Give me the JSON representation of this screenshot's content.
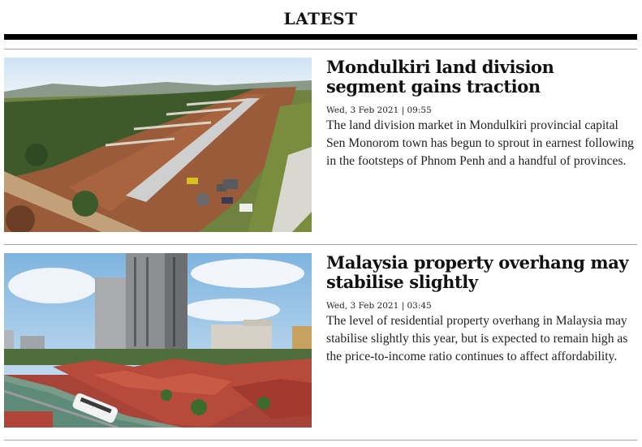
{
  "section": {
    "title": "LATEST"
  },
  "articles": [
    {
      "headline": "Mondulkiri land division segment gains traction",
      "date": "Wed, 3 Feb 2021 | 09:55",
      "summary": "The land division market in Mondulkiri provincial capital Sen Monorom town has begun to sprout in earnest following in the footsteps of Phnom Penh and a handful of provinces.",
      "image": "aerial-photo-land-plots"
    },
    {
      "headline": "Malaysia property overhang may stabilise slightly",
      "date": "Wed, 3 Feb 2021 | 03:45",
      "summary": "The level of residential property overhang in Malaysia may stabilise slightly this year, but is expected to remain high as the price-to-income ratio continues to affect affordability.",
      "image": "city-river-skyline-photo"
    }
  ]
}
